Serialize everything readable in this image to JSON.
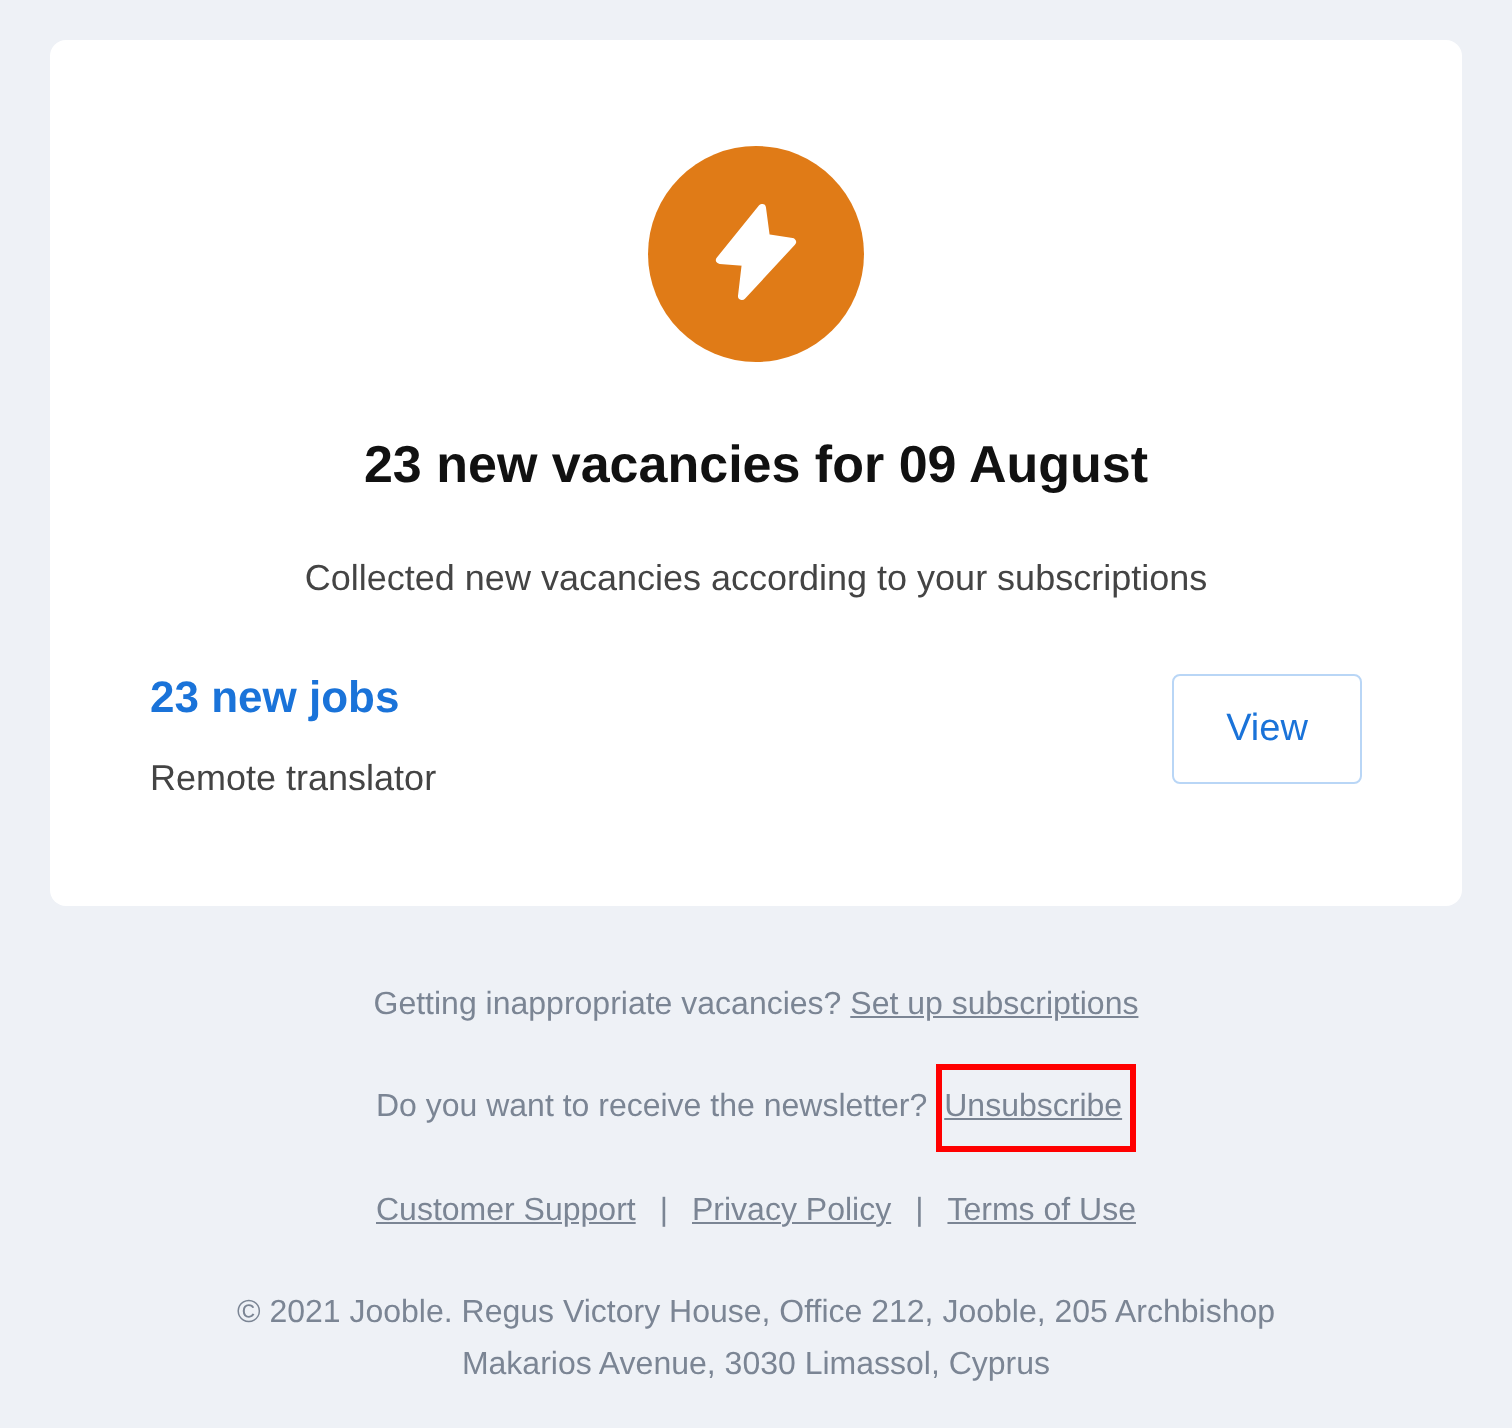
{
  "card": {
    "title": "23 new vacancies for 09 August",
    "subtitle": "Collected new vacancies according to your subscriptions",
    "job": {
      "count": "23 new jobs",
      "query": "Remote translator",
      "button": "View"
    }
  },
  "footer": {
    "notes": [
      {
        "text": "Getting inappropriate vacancies?",
        "link": {
          "label": "Set up subscriptions",
          "highlighted": false
        }
      },
      {
        "text": "Do you want to receive the newsletter?",
        "link": {
          "label": "Unsubscribe",
          "highlighted": true
        }
      }
    ],
    "links": [
      {
        "label": "Customer Support",
        "highlighted": false
      },
      {
        "label": "Privacy Policy",
        "highlighted": false
      },
      {
        "label": "Terms of Use",
        "highlighted": false
      }
    ],
    "separators": [
      "|",
      "|"
    ],
    "copyright": "© 2021 Jooble. Regus Victory House, Office 212, Jooble, 205 Archbishop Makarios Avenue, 3030 Limassol, Cyprus"
  }
}
